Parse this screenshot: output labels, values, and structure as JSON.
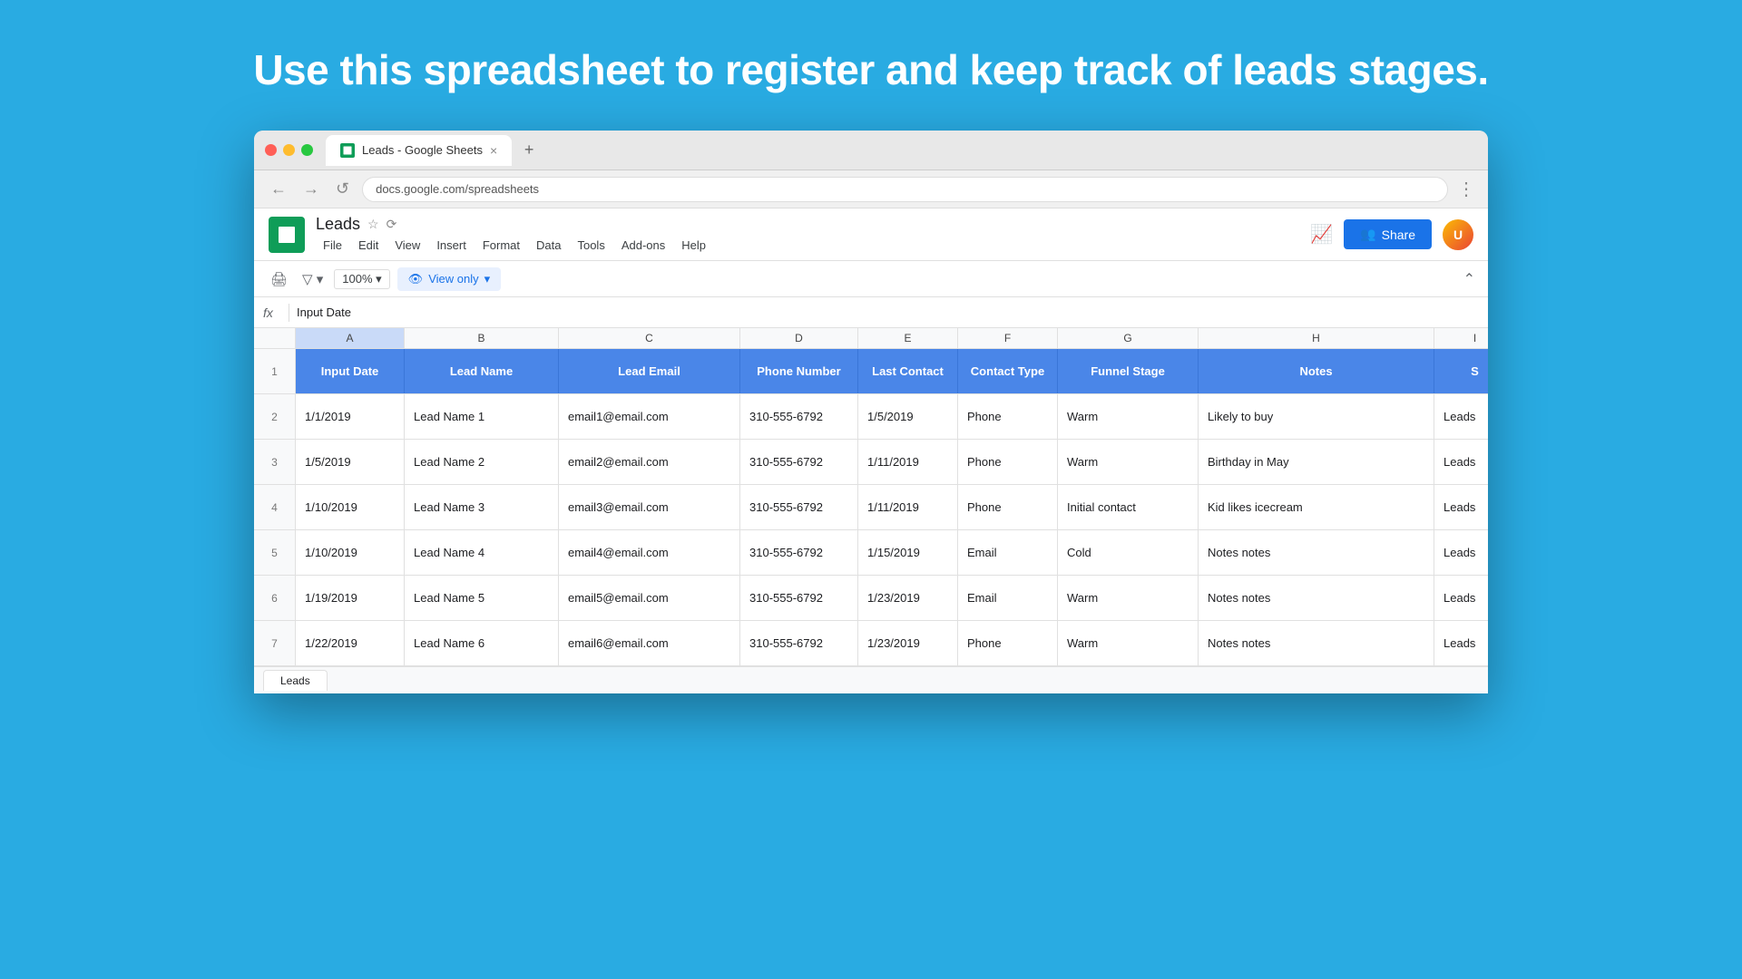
{
  "page": {
    "background_color": "#29abe2",
    "hero_text": "Use this spreadsheet to register and keep track of leads stages."
  },
  "browser": {
    "tab_title": "Leads - Google Sheets",
    "address_bar_url": "docs.google.com/spreadsheets",
    "nav_back": "←",
    "nav_forward": "→",
    "nav_reload": "↺"
  },
  "sheets": {
    "title": "Leads",
    "menu_items": [
      "File",
      "Edit",
      "View",
      "Insert",
      "Format",
      "Data",
      "Tools",
      "Add-ons",
      "Help"
    ],
    "zoom": "100%",
    "view_only_label": "View only",
    "share_label": "Share",
    "formula_bar_content": "Input Date",
    "columns": [
      {
        "letter": "A",
        "label": "Input Date",
        "selected": true
      },
      {
        "letter": "B",
        "label": "Lead Name",
        "selected": false
      },
      {
        "letter": "C",
        "label": "Lead Email",
        "selected": false
      },
      {
        "letter": "D",
        "label": "Phone Number",
        "selected": false
      },
      {
        "letter": "E",
        "label": "Last Contact",
        "selected": false
      },
      {
        "letter": "F",
        "label": "Contact Type",
        "selected": false
      },
      {
        "letter": "G",
        "label": "Funnel Stage",
        "selected": false
      },
      {
        "letter": "H",
        "label": "Notes",
        "selected": false
      },
      {
        "letter": "I",
        "label": "S",
        "selected": false
      }
    ],
    "rows": [
      {
        "row_num": "2",
        "input_date": "1/1/2019",
        "lead_name": "Lead Name 1",
        "lead_email": "email1@email.com",
        "phone": "310-555-6792",
        "last_contact": "1/5/2019",
        "contact_type": "Phone",
        "funnel_stage": "Warm",
        "notes": "Likely to buy",
        "sheet": "Leads"
      },
      {
        "row_num": "3",
        "input_date": "1/5/2019",
        "lead_name": "Lead Name 2",
        "lead_email": "email2@email.com",
        "phone": "310-555-6792",
        "last_contact": "1/11/2019",
        "contact_type": "Phone",
        "funnel_stage": "Warm",
        "notes": "Birthday in May",
        "sheet": "Leads"
      },
      {
        "row_num": "4",
        "input_date": "1/10/2019",
        "lead_name": "Lead Name 3",
        "lead_email": "email3@email.com",
        "phone": "310-555-6792",
        "last_contact": "1/11/2019",
        "contact_type": "Phone",
        "funnel_stage": "Initial contact",
        "notes": "Kid likes icecream",
        "sheet": "Leads"
      },
      {
        "row_num": "5",
        "input_date": "1/10/2019",
        "lead_name": "Lead Name 4",
        "lead_email": "email4@email.com",
        "phone": "310-555-6792",
        "last_contact": "1/15/2019",
        "contact_type": "Email",
        "funnel_stage": "Cold",
        "notes": "Notes notes",
        "sheet": "Leads"
      },
      {
        "row_num": "6",
        "input_date": "1/19/2019",
        "lead_name": "Lead Name 5",
        "lead_email": "email5@email.com",
        "phone": "310-555-6792",
        "last_contact": "1/23/2019",
        "contact_type": "Email",
        "funnel_stage": "Warm",
        "notes": "Notes notes",
        "sheet": "Leads"
      },
      {
        "row_num": "7",
        "input_date": "1/22/2019",
        "lead_name": "Lead Name 6",
        "lead_email": "email6@email.com",
        "phone": "310-555-6792",
        "last_contact": "1/23/2019",
        "contact_type": "Phone",
        "funnel_stage": "Warm",
        "notes": "Notes notes",
        "sheet": "Leads"
      }
    ],
    "sheet_tab_label": "Leads"
  }
}
